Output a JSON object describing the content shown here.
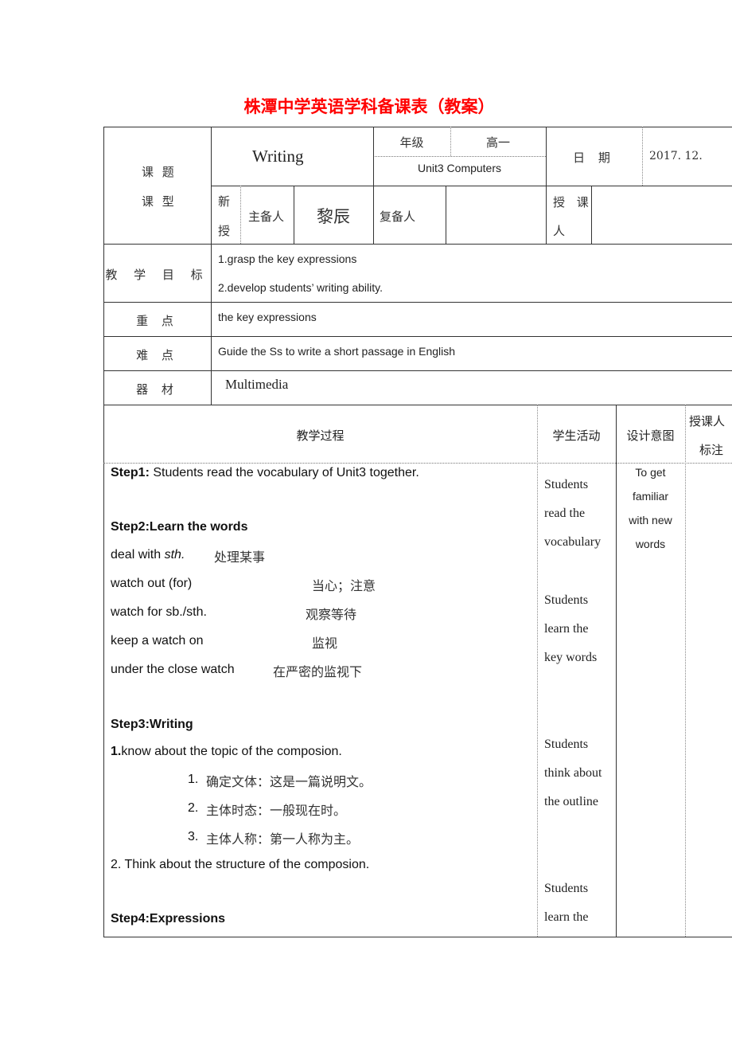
{
  "document": {
    "title": "株潭中学英语学科备课表（教案）"
  },
  "header": {
    "topic_label": "课 题",
    "type_label": "课 型",
    "topic_value": "Writing",
    "grade_label": "年级",
    "grade_value": "高一",
    "unit_value": "Unit3 Computers",
    "date_label": "日 期",
    "date_value": "2017. 12.",
    "type_value_line1": "新",
    "type_value_line2": "授",
    "main_preparer_label": "主备人",
    "main_preparer_value": "黎辰",
    "co_preparer_label": "复备人",
    "co_preparer_value": "",
    "teacher_label_line1": "授 课",
    "teacher_label_line2": "人",
    "teacher_value": ""
  },
  "objectives": {
    "label": "教 学 目 标",
    "items": [
      "1.grasp the key expressions",
      "2.develop students’ writing ability."
    ]
  },
  "key_points": {
    "label": "重 点",
    "value": "the key expressions"
  },
  "difficulties": {
    "label": "难 点",
    "value": "Guide the Ss to write a short passage in English"
  },
  "materials": {
    "label": "器 材",
    "value": "Multimedia"
  },
  "process_table": {
    "headers": {
      "process": "教学过程",
      "student_activity": "学生活动",
      "design_intent": "设计意图",
      "teacher_notes_line1": "授课人",
      "teacher_notes_line2": "标注"
    },
    "step1": {
      "label": "Step1:",
      "text": " Students read the vocabulary of Unit3 together."
    },
    "step2": {
      "label": "Step2:Learn the words",
      "words": [
        {
          "en": "deal with ",
          "en_italic": "sth.",
          "cn": "处理某事"
        },
        {
          "en": "watch out (for)",
          "en_italic": "",
          "cn": "当心；注意"
        },
        {
          "en": "watch for sb./sth.",
          "en_italic": "",
          "cn": "观察等待"
        },
        {
          "en": "keep a watch on",
          "en_italic": "",
          "cn": "监视"
        },
        {
          "en": "under the close watch",
          "en_italic": "",
          "cn": "在严密的监视下"
        }
      ]
    },
    "step3": {
      "label": "Step3:Writing",
      "point1_num": "1.",
      "point1": "know about the topic of the composion.",
      "sub_items": [
        {
          "num": "1.",
          "text": "确定文体：这是一篇说明文。"
        },
        {
          "num": "2.",
          "text": "主体时态：一般现在时。"
        },
        {
          "num": "3.",
          "text": "主体人称：第一人称为主。"
        }
      ],
      "point2": "2. Think about the structure of the composion."
    },
    "step4": {
      "label": "Step4:Expressions"
    },
    "student_activities": [
      [
        "Students",
        "read the",
        "vocabulary"
      ],
      [
        "Students",
        "learn the",
        "key words"
      ],
      [
        "Students",
        "think about",
        "the outline"
      ],
      [
        "Students",
        "learn the"
      ]
    ],
    "design_intent": [
      "To get",
      "familiar",
      "with new",
      "words"
    ]
  },
  "colors": {
    "title": "#ff0000",
    "border": "#333333",
    "text": "#222222"
  }
}
